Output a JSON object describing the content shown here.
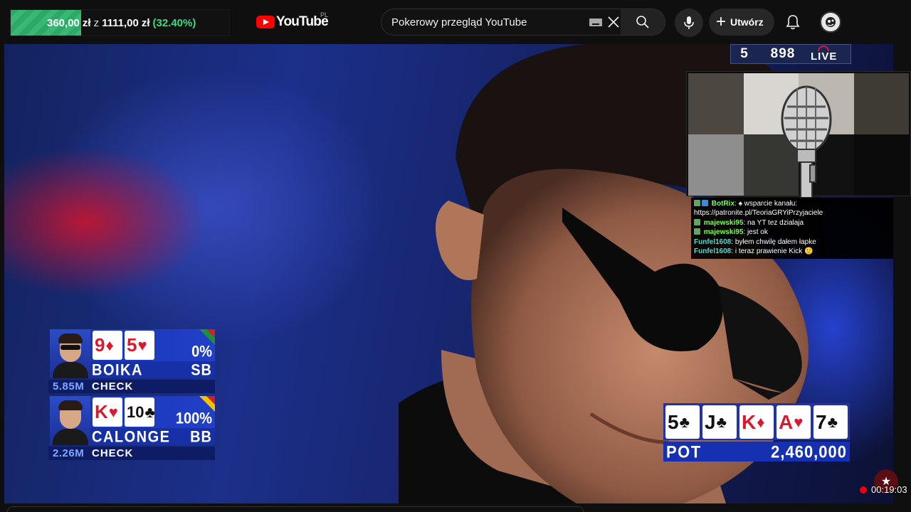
{
  "donation": {
    "current": "360,00",
    "current_unit": "zł",
    "separator": "z",
    "goal": "1111,00",
    "goal_unit": "zł",
    "percent": "(32.40%)",
    "fill_fraction": 0.324,
    "fill_color": "#2ea866"
  },
  "header": {
    "logo_text": "YouTube",
    "country_code": "PL",
    "search_value": "Pokerowy przegląd YouTube",
    "create_label": "Utwórz",
    "icons": [
      "keyboard-icon",
      "close-icon",
      "search-icon",
      "mic-icon",
      "plus-icon",
      "bell-icon",
      "avatar"
    ]
  },
  "live_badge": {
    "left_number": "5",
    "right_number": "898",
    "live_text": "LIVE",
    "accent": "#e0163c"
  },
  "chat": {
    "messages": [
      {
        "nick": "BotRix",
        "text": "♠ wsparcie kanału:",
        "nick_color": "#7cfc5c",
        "has_badges": true
      },
      {
        "nick": "",
        "text": "https://patronite.pl/TeoriaGRYiPrzyjaciele",
        "nick_color": "#ffffff",
        "has_badges": false
      },
      {
        "nick": "majewski95",
        "text": "na YT tez dzialaja",
        "nick_color": "#7cfc5c",
        "has_badges": true
      },
      {
        "nick": "majewski95",
        "text": "jest ok",
        "nick_color": "#7cfc5c",
        "has_badges": true
      },
      {
        "nick": "Funfel1608",
        "text": "byłem chwilę dałem łapke",
        "nick_color": "#58d7d1",
        "has_badges": false
      },
      {
        "nick": "Funfel1608",
        "text": "i teraz prawienie Kick 🙂",
        "nick_color": "#58d7d1",
        "has_badges": false
      }
    ]
  },
  "players": [
    {
      "name": "BOIKA",
      "cards": [
        {
          "rank": "9",
          "suit": "♦",
          "color": "red"
        },
        {
          "rank": "5",
          "suit": "♥",
          "color": "red"
        }
      ],
      "equity": "0%",
      "position": "SB",
      "stack": "5.85M",
      "action": "CHECK",
      "glasses": true
    },
    {
      "name": "CALONGE",
      "cards": [
        {
          "rank": "K",
          "suit": "♥",
          "color": "red"
        },
        {
          "rank": "10",
          "suit": "♣",
          "color": "black"
        }
      ],
      "equity": "100%",
      "position": "BB",
      "stack": "2.26M",
      "action": "CHECK",
      "glasses": false
    }
  ],
  "board": {
    "cards": [
      {
        "rank": "5",
        "suit": "♣",
        "color": "black"
      },
      {
        "rank": "J",
        "suit": "♣",
        "color": "black"
      },
      {
        "rank": "K",
        "suit": "♦",
        "color": "red"
      },
      {
        "rank": "A",
        "suit": "♥",
        "color": "red"
      },
      {
        "rank": "7",
        "suit": "♣",
        "color": "black"
      }
    ],
    "pot_label": "POT",
    "pot_value": "2,460,000"
  },
  "recording": {
    "time": "00:19:03",
    "dot_color": "#ee0000"
  }
}
